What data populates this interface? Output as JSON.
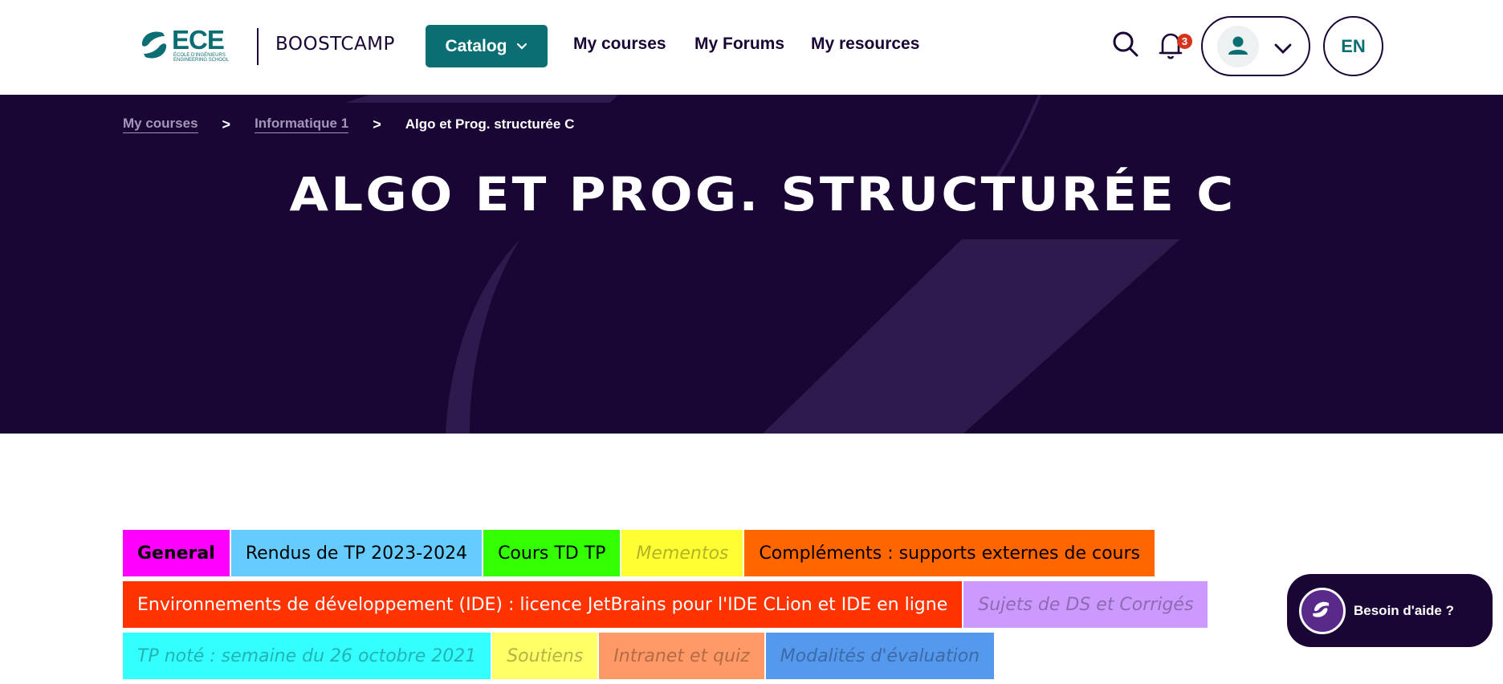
{
  "navbar": {
    "logo": {
      "word": "ECE",
      "subtitle": "ÉCOLE D'INGÉNIEURS ENGINEERING SCHOOL"
    },
    "brand": "BOOSTCAMP",
    "catalog_label": "Catalog",
    "links": [
      "My courses",
      "My Forums",
      "My resources"
    ],
    "notification_count": "3",
    "language": "EN",
    "icons": {
      "search": "search-icon",
      "bell": "bell-icon",
      "user": "user-icon",
      "chevron": "chevron-down-icon"
    }
  },
  "hero": {
    "breadcrumb": {
      "items": [
        "My courses",
        "Informatique 1"
      ],
      "current": "Algo et Prog. structurée C",
      "separator": ">"
    },
    "title": "ALGO ET PROG. STRUCTURÉE C"
  },
  "tabs": {
    "rows": [
      [
        {
          "label": "General",
          "color": "#ff00ff",
          "bold": true
        },
        {
          "label": "Rendus de TP 2023-2024",
          "color": "#66ccff"
        },
        {
          "label": "Cours TD TP",
          "color": "#33ff00"
        },
        {
          "label": "Mementos",
          "color": "#ffff33",
          "faded": true
        },
        {
          "label": "Compléments : supports externes de cours",
          "color": "#ff6600"
        }
      ],
      [
        {
          "label": "Environnements de développement (IDE) : licence JetBrains pour l'IDE CLion et IDE en ligne",
          "color": "#ff3300",
          "light_text": true
        },
        {
          "label": "Sujets de DS et Corrigés",
          "color": "#cc99ff",
          "faded": true
        }
      ],
      [
        {
          "label": "TP noté : semaine du 26 octobre 2021",
          "color": "#33ffff",
          "faded": true
        },
        {
          "label": "Soutiens",
          "color": "#ffff66",
          "faded": true
        },
        {
          "label": "Intranet et quiz",
          "color": "#ff9966",
          "faded": true
        },
        {
          "label": "Modalités d'évaluation",
          "color": "#5599ee",
          "faded": true
        }
      ]
    ]
  },
  "help": {
    "label": "Besoin d'aide ?"
  },
  "colors": {
    "primary_dark": "#1a0634",
    "teal": "#0b6e73",
    "badge": "#d7341f"
  }
}
